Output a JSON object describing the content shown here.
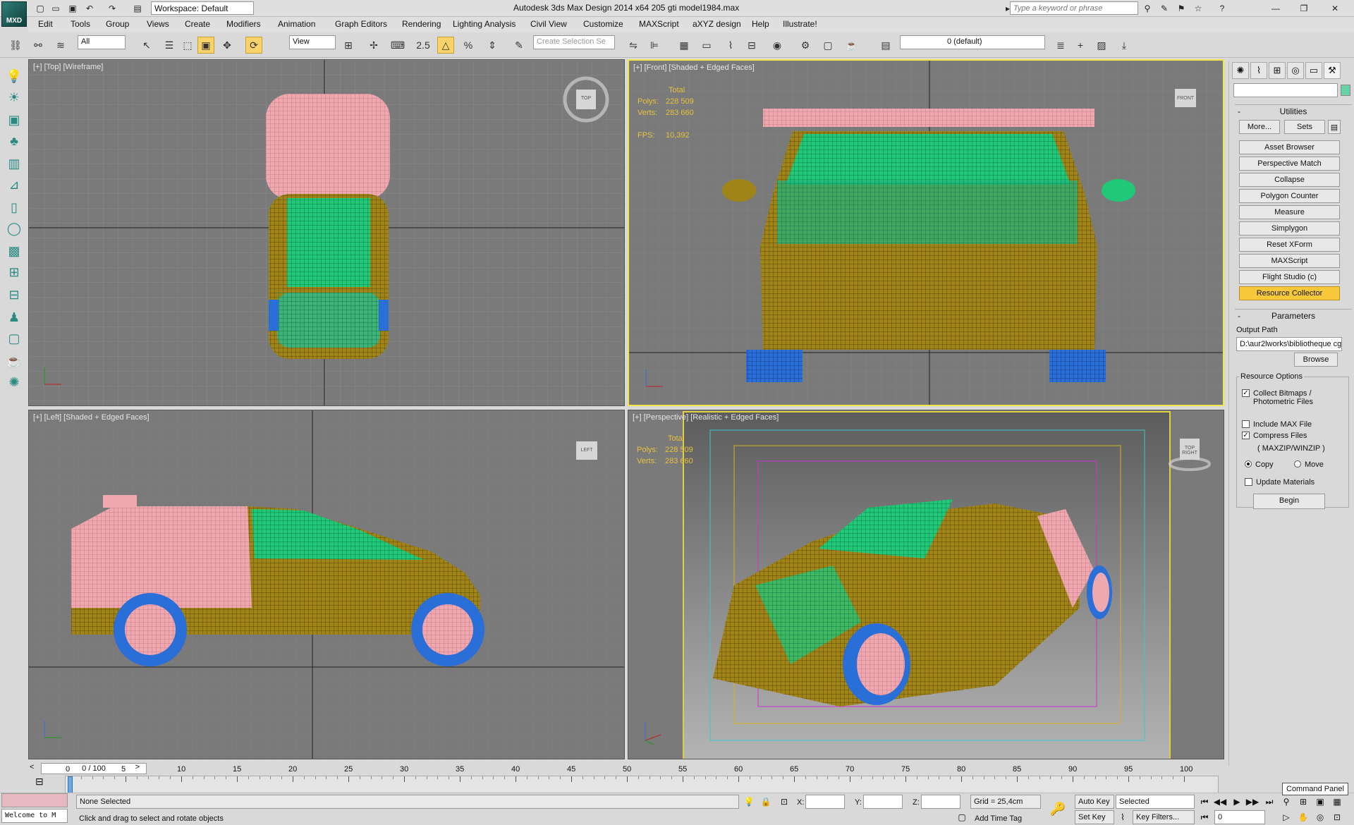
{
  "app": {
    "logo": "MXD",
    "workspace": "Workspace: Default",
    "title": "Autodesk 3ds Max Design 2014 x64     205 gti model1984.max",
    "search_placeholder": "Type a keyword or phrase"
  },
  "menu": [
    "Edit",
    "Tools",
    "Group",
    "Views",
    "Create",
    "Modifiers",
    "Animation",
    "Graph Editors",
    "Rendering",
    "Lighting Analysis",
    "Civil View",
    "Customize",
    "MAXScript",
    "aXYZ design",
    "Help",
    "Illustrate!"
  ],
  "toolbar": {
    "filter": "All",
    "refcoord": "View",
    "snap_value": "2.5",
    "selection_set_placeholder": "Create Selection Se",
    "layer": "0 (default)"
  },
  "viewports": {
    "top": {
      "label": "[+] [Top] [Wireframe]",
      "cube": "TOP"
    },
    "front": {
      "label": "[+] [Front] [Shaded + Edged Faces]",
      "cube": "FRONT",
      "stats": {
        "total": "Total",
        "polys_label": "Polys:",
        "polys": "228 509",
        "verts_label": "Verts:",
        "verts": "283 660",
        "fps_label": "FPS:",
        "fps": "10,392"
      }
    },
    "left": {
      "label": "[+] [Left] [Shaded + Edged Faces]",
      "cube": "LEFT"
    },
    "persp": {
      "label": "[+] [Perspective] [Realistic + Edged Faces]",
      "cube": "TOP RIGHT",
      "stats": {
        "total": "Total",
        "polys_label": "Polys:",
        "polys": "228 509",
        "verts_label": "Verts:",
        "verts": "283 660"
      }
    }
  },
  "command_panel": {
    "more": "More...",
    "sets": "Sets",
    "utilities": "Utilities",
    "buttons": [
      "Asset Browser",
      "Perspective Match",
      "Collapse",
      "Polygon Counter",
      "Measure",
      "Simplygon",
      "Reset XForm",
      "MAXScript",
      "Flight Studio (c)",
      "Resource Collector"
    ],
    "parameters": "Parameters",
    "output_path_label": "Output Path",
    "output_path": "D:\\aur2lworks\\bibliotheque cg",
    "browse": "Browse",
    "resource_options": "Resource Options",
    "collect_bitmaps": "Collect Bitmaps /",
    "photometric": "Photometric Files",
    "include_max": "Include MAX File",
    "compress": "Compress Files",
    "zip": "( MAXZIP/WINZIP )",
    "copy": "Copy",
    "move": "Move",
    "update_materials": "Update Materials",
    "begin": "Begin",
    "tooltip": "Command Panel"
  },
  "timeline": {
    "slider": "0 / 100",
    "ticks": [
      "0",
      "5",
      "10",
      "15",
      "20",
      "25",
      "30",
      "35",
      "40",
      "45",
      "50",
      "55",
      "60",
      "65",
      "70",
      "75",
      "80",
      "85",
      "90",
      "95",
      "100"
    ]
  },
  "status": {
    "maxscript": "Welcome to M",
    "selection": "None Selected",
    "prompt": "Click and drag to select and rotate objects",
    "x": "X:",
    "y": "Y:",
    "z": "Z:",
    "grid": "Grid = 25,4cm",
    "add_time_tag": "Add Time Tag",
    "auto_key": "Auto Key",
    "set_key": "Set Key",
    "selected": "Selected",
    "key_filters": "Key Filters...",
    "frame": "0"
  },
  "colors": {
    "pink": "#f0a8b0",
    "olive": "#a08418",
    "green": "#20c878",
    "blue": "#2a6ed8",
    "highlight": "#f7c93a"
  }
}
